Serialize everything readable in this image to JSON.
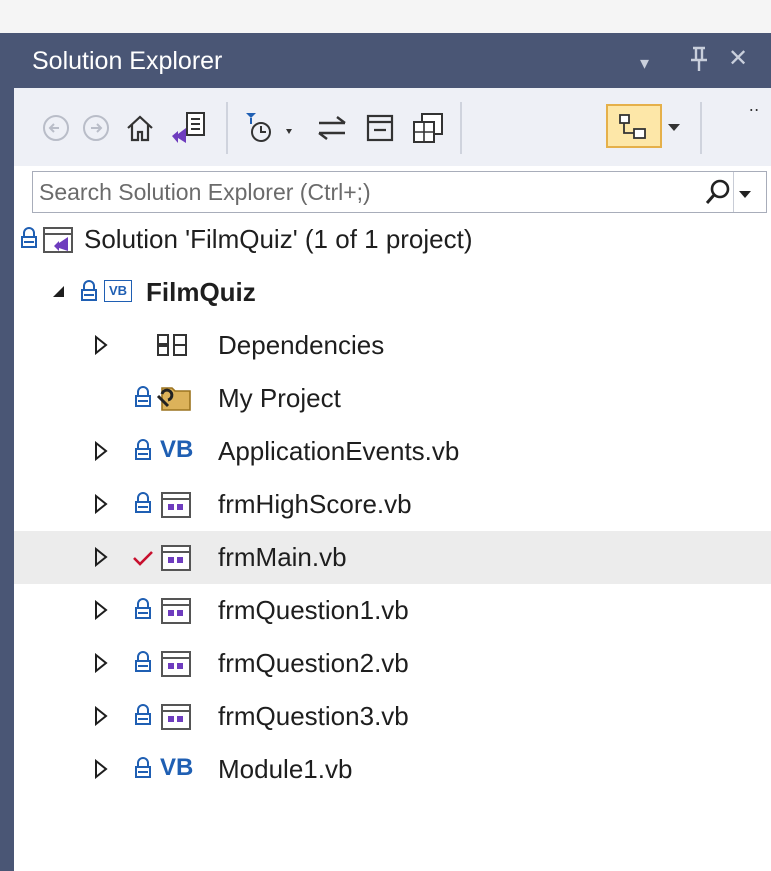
{
  "window": {
    "title": "Solution Explorer",
    "buttons": {
      "menu": "▾",
      "pin": "⊥",
      "close": "✕"
    }
  },
  "toolbar": {
    "buttons": [
      "back-icon",
      "forward-icon",
      "home-icon",
      "switch-views-icon",
      "pending-changes-filter-icon",
      "sync-with-active-document-icon",
      "collapse-all-icon",
      "show-all-files-icon",
      "toggle-view-icon"
    ],
    "overflow": "‥"
  },
  "search": {
    "placeholder": "Search Solution Explorer (Ctrl+;)"
  },
  "tree": {
    "solution": "Solution 'FilmQuiz' (1 of 1 project)",
    "project": "FilmQuiz",
    "project_icon_text": "VB",
    "vb_badge": "VB",
    "items": [
      {
        "label": "Dependencies",
        "icon": "dependencies-icon"
      },
      {
        "label": "My Project",
        "icon": "my-project-icon"
      },
      {
        "label": "ApplicationEvents.vb",
        "icon": "vb-file-icon"
      },
      {
        "label": "frmHighScore.vb",
        "icon": "form-icon"
      },
      {
        "label": "frmMain.vb",
        "icon": "form-icon",
        "status": "checked-out",
        "selected": true
      },
      {
        "label": "frmQuestion1.vb",
        "icon": "form-icon"
      },
      {
        "label": "frmQuestion2.vb",
        "icon": "form-icon"
      },
      {
        "label": "frmQuestion3.vb",
        "icon": "form-icon"
      },
      {
        "label": "Module1.vb",
        "icon": "vb-file-icon"
      }
    ]
  },
  "colors": {
    "titlebar": "#4a5675",
    "toolbar": "#eef0f6",
    "selected_row": "#ececec",
    "lock_blue": "#1f5fb3",
    "checkmark_red": "#c8102e",
    "vs_purple": "#6e3cbe"
  }
}
